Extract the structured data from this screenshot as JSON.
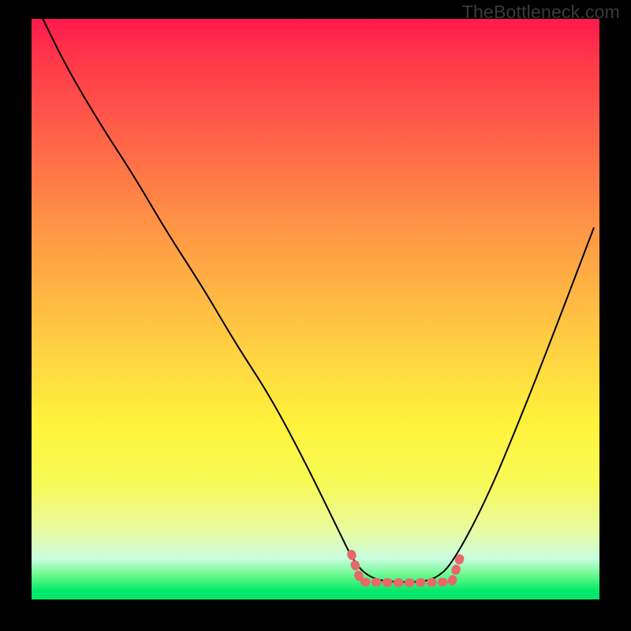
{
  "watermark": "TheBottleneck.com",
  "chart_data": {
    "type": "line",
    "title": "",
    "xlabel": "",
    "ylabel": "",
    "xlim": [
      0,
      100
    ],
    "ylim": [
      0,
      100
    ],
    "series": [
      {
        "name": "curve",
        "x": [
          2,
          6,
          12,
          18,
          24,
          30,
          36,
          42,
          48,
          54,
          57,
          60,
          64,
          68,
          71,
          74,
          80,
          86,
          92,
          99
        ],
        "values": [
          100,
          92,
          82,
          73,
          63,
          54,
          44,
          35,
          24,
          12,
          6,
          3.5,
          3,
          3,
          3.5,
          6,
          17,
          31,
          46,
          64
        ]
      }
    ],
    "plateau": {
      "x_start": 58,
      "x_end": 74,
      "value": 3
    },
    "gradient_stops": [
      {
        "pos": 0.0,
        "color": "#ff1a4d"
      },
      {
        "pos": 0.22,
        "color": "#ff6848"
      },
      {
        "pos": 0.46,
        "color": "#ffb244"
      },
      {
        "pos": 0.7,
        "color": "#fff33c"
      },
      {
        "pos": 0.88,
        "color": "#e8fb9f"
      },
      {
        "pos": 0.96,
        "color": "#64f98a"
      },
      {
        "pos": 1.0,
        "color": "#04e86a"
      }
    ]
  }
}
